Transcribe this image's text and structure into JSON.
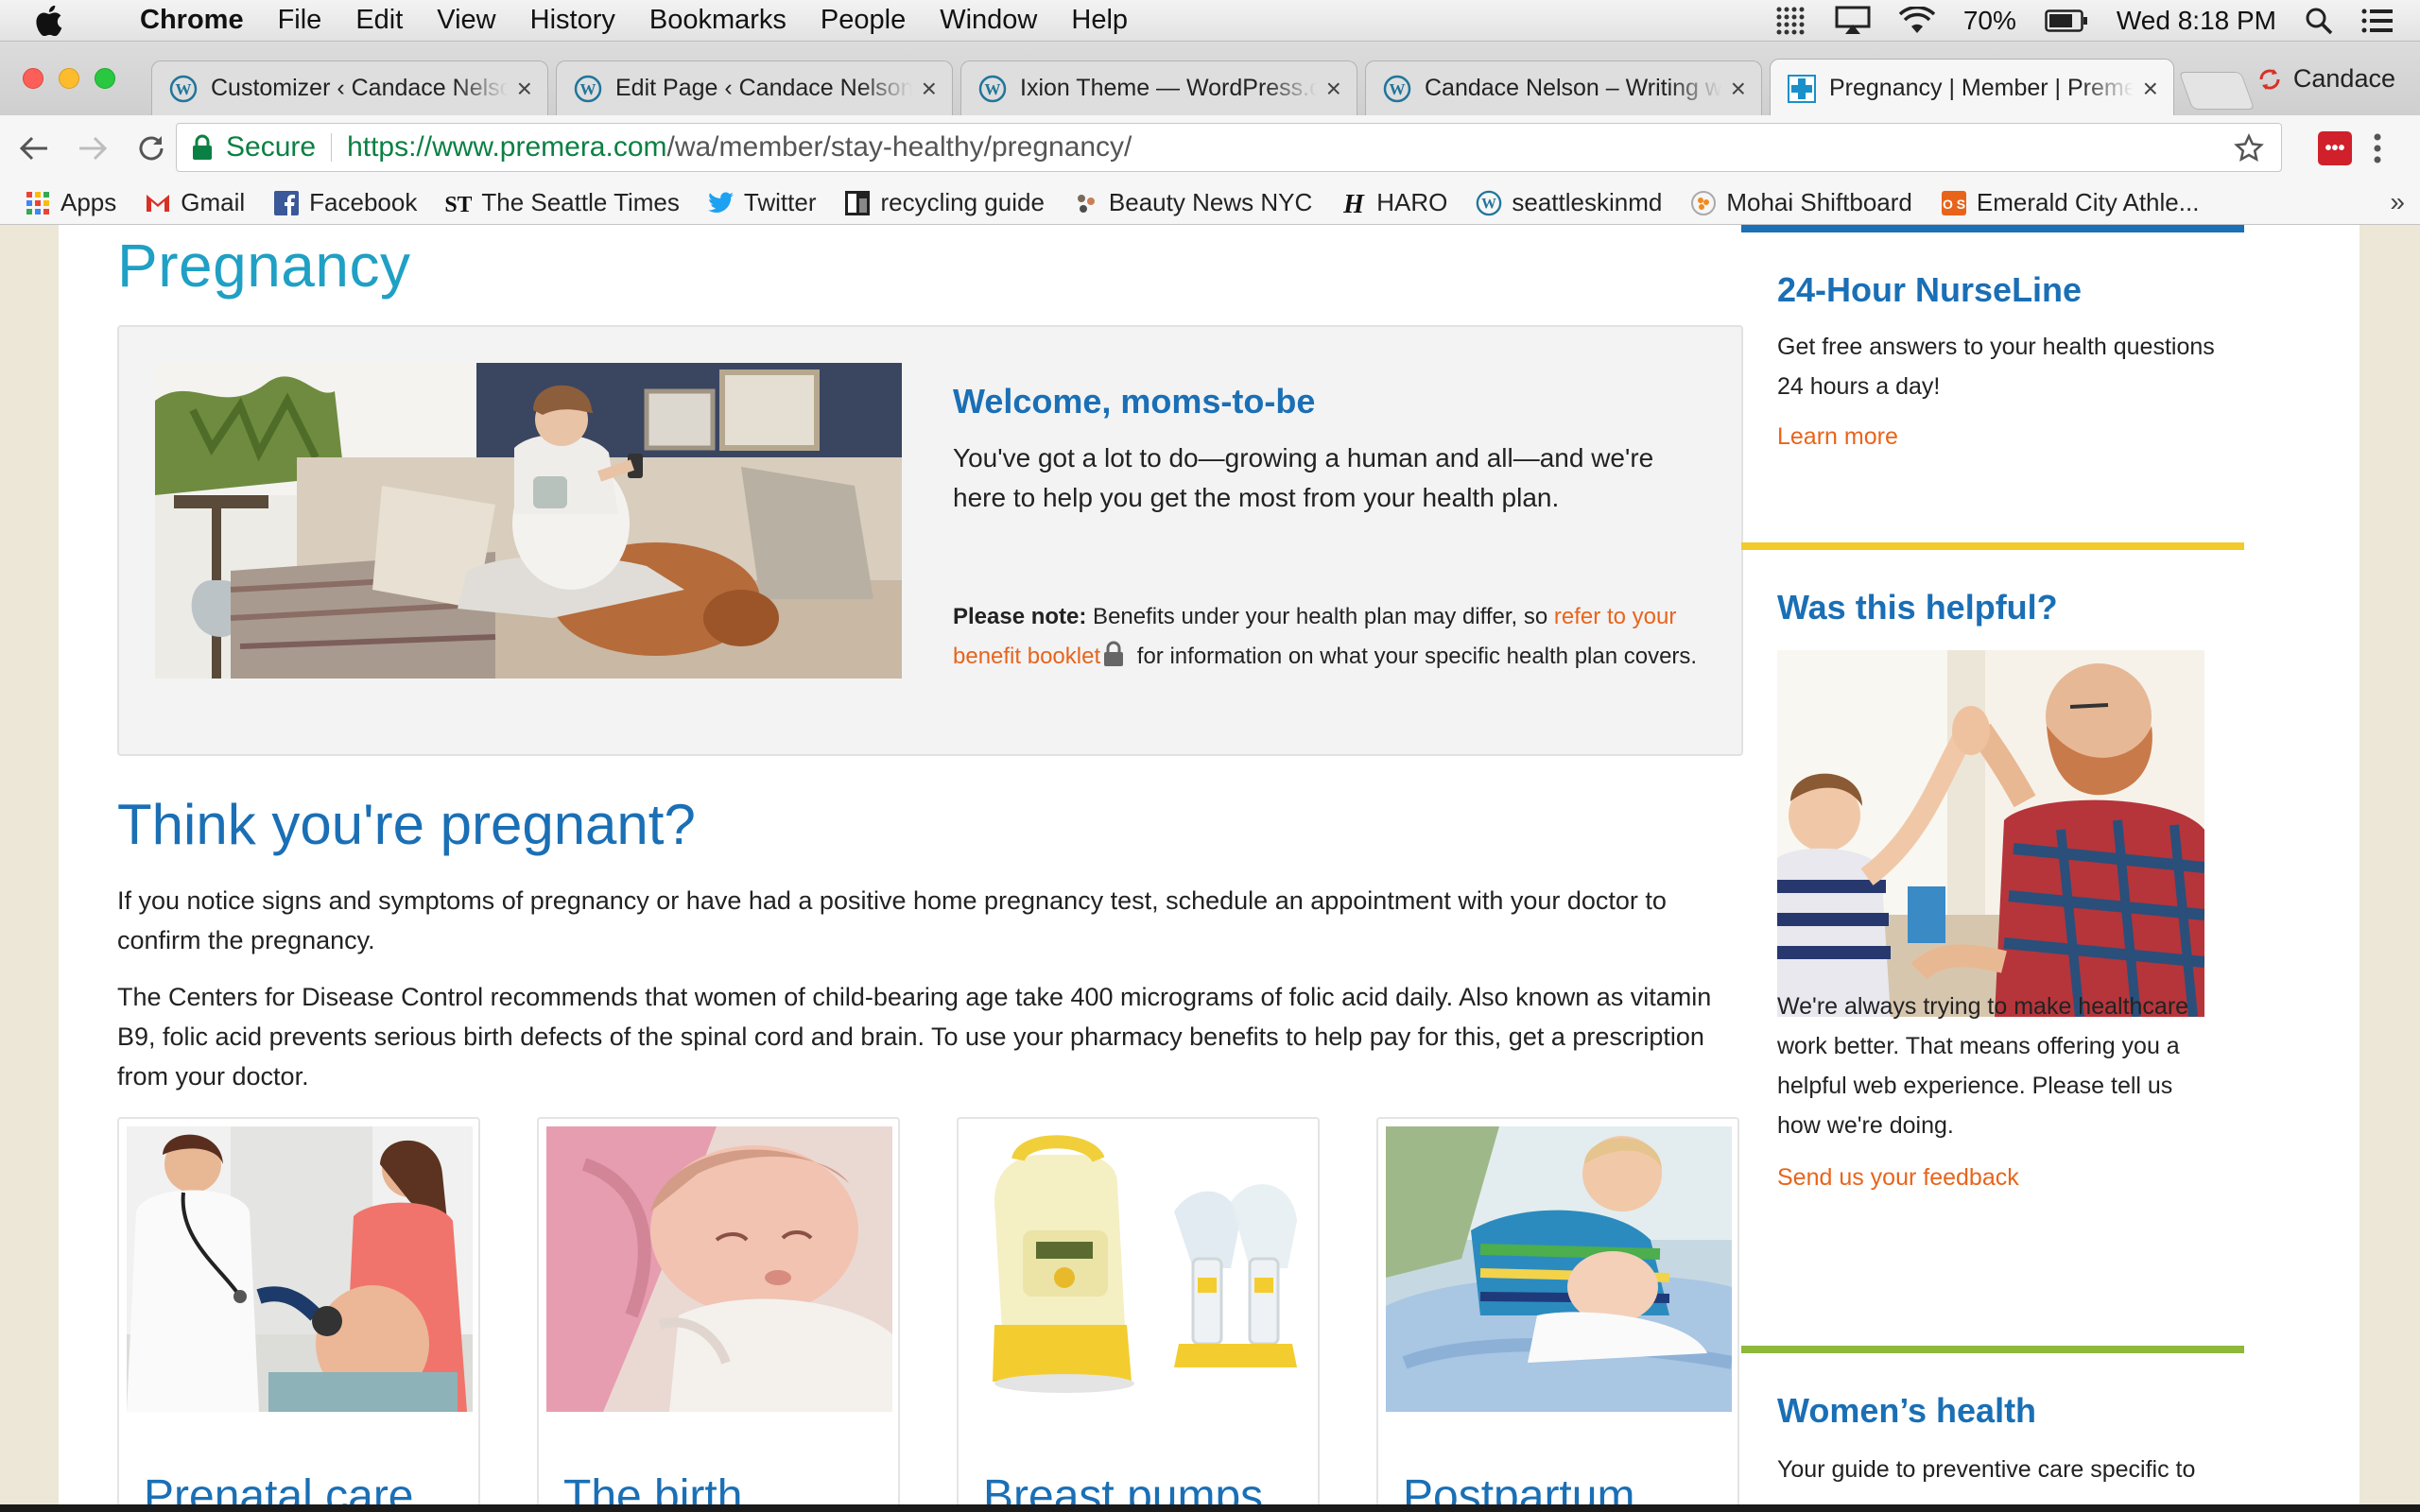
{
  "menubar": {
    "app_name": "Chrome",
    "items": [
      "File",
      "Edit",
      "View",
      "History",
      "Bookmarks",
      "People",
      "Window",
      "Help"
    ],
    "battery": "70%",
    "clock": "Wed 8:18 PM"
  },
  "tabs": [
    {
      "title": "Customizer ‹ Candace Nelson — WordPress"
    },
    {
      "title": "Edit Page ‹ Candace Nelson — WordPress"
    },
    {
      "title": "Ixion Theme — WordPress.com"
    },
    {
      "title": "Candace Nelson – Writing w"
    },
    {
      "title": "Pregnancy | Member | Premera"
    }
  ],
  "profile_name": "Candace",
  "address_bar": {
    "secure_label": "Secure",
    "url_host": "https://www.premera.com",
    "url_path": "/wa/member/stay-healthy/pregnancy/"
  },
  "bookmarks": [
    {
      "label": "Apps"
    },
    {
      "label": "Gmail"
    },
    {
      "label": "Facebook"
    },
    {
      "label": "The Seattle Times"
    },
    {
      "label": "Twitter"
    },
    {
      "label": "recycling guide"
    },
    {
      "label": "Beauty News NYC"
    },
    {
      "label": "HARO"
    },
    {
      "label": "seattleskinmd"
    },
    {
      "label": "Mohai Shiftboard"
    },
    {
      "label": "Emerald City Athle..."
    }
  ],
  "bookmarks_more": "»",
  "main": {
    "page_title": "Pregnancy",
    "welcome": {
      "title": "Welcome, moms-to-be",
      "text": "You've got a lot to do—growing a human and all—and we're here to help you get the most from your health plan.",
      "note_label": "Please note:",
      "note_before": " Benefits under your health plan may differ, so ",
      "note_link": "refer to your benefit booklet",
      "note_after": " for information on what your specific health plan covers."
    },
    "section_title": "Think you're pregnant?",
    "paragraph1": "If you notice signs and symptoms of pregnancy or have had a positive home pregnancy test, schedule an appointment with your doctor to confirm the pregnancy.",
    "paragraph2": "The Centers for Disease Control recommends that women of child-bearing age take 400 micrograms of folic acid daily. Also known as vitamin B9, folic acid prevents serious birth defects of the spinal cord and brain. To use your pharmacy benefits to help pay for this, get a prescription from your doctor.",
    "cards": [
      {
        "title": "Prenatal care"
      },
      {
        "title": "The birth"
      },
      {
        "title": "Breast pumps"
      },
      {
        "title": "Postpartum"
      }
    ]
  },
  "sidebar": {
    "nurseline": {
      "title": "24-Hour NurseLine",
      "text": "Get free answers to your health questions 24 hours a day!",
      "link": "Learn more",
      "color": "#1a6fb5"
    },
    "helpful": {
      "title": "Was this helpful?",
      "text": "We're always trying to make healthcare work better. That means offering you a helpful web experience. Please tell us how we're doing.",
      "link": "Send us your feedback",
      "color": "#f2cb2b"
    },
    "womens": {
      "title": "Women’s health",
      "text": "Your guide to preventive care specific to",
      "color": "#8db83a"
    }
  },
  "colors": {
    "title_teal": "#1fa0c4",
    "heading_blue": "#1a6fb5",
    "link_orange": "#e8641b"
  }
}
